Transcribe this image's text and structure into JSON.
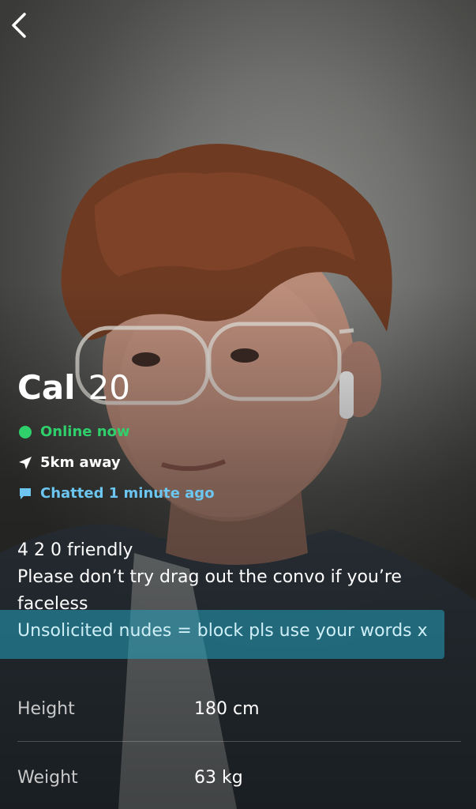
{
  "profile": {
    "name": "Cal",
    "age": "20",
    "online_status": "Online now",
    "distance": "5km away",
    "chatted": "Chatted 1 minute ago"
  },
  "bio": {
    "line1": "4 2 0 friendly",
    "line2": "Please don’t try drag out the convo if you’re",
    "line3": "faceless",
    "line4": "Unsolicited nudes = block pls use your words x"
  },
  "stats": [
    {
      "label": "Height",
      "value": "180 cm"
    },
    {
      "label": "Weight",
      "value": "63 kg"
    }
  ],
  "icons": {
    "back": "chevron-left-icon",
    "online": "online-dot-icon",
    "distance": "location-arrow-icon",
    "chat": "chat-bubble-icon"
  },
  "colors": {
    "online": "#2fd06b",
    "chat": "#6cc6f0",
    "highlight": "#23a0be"
  }
}
